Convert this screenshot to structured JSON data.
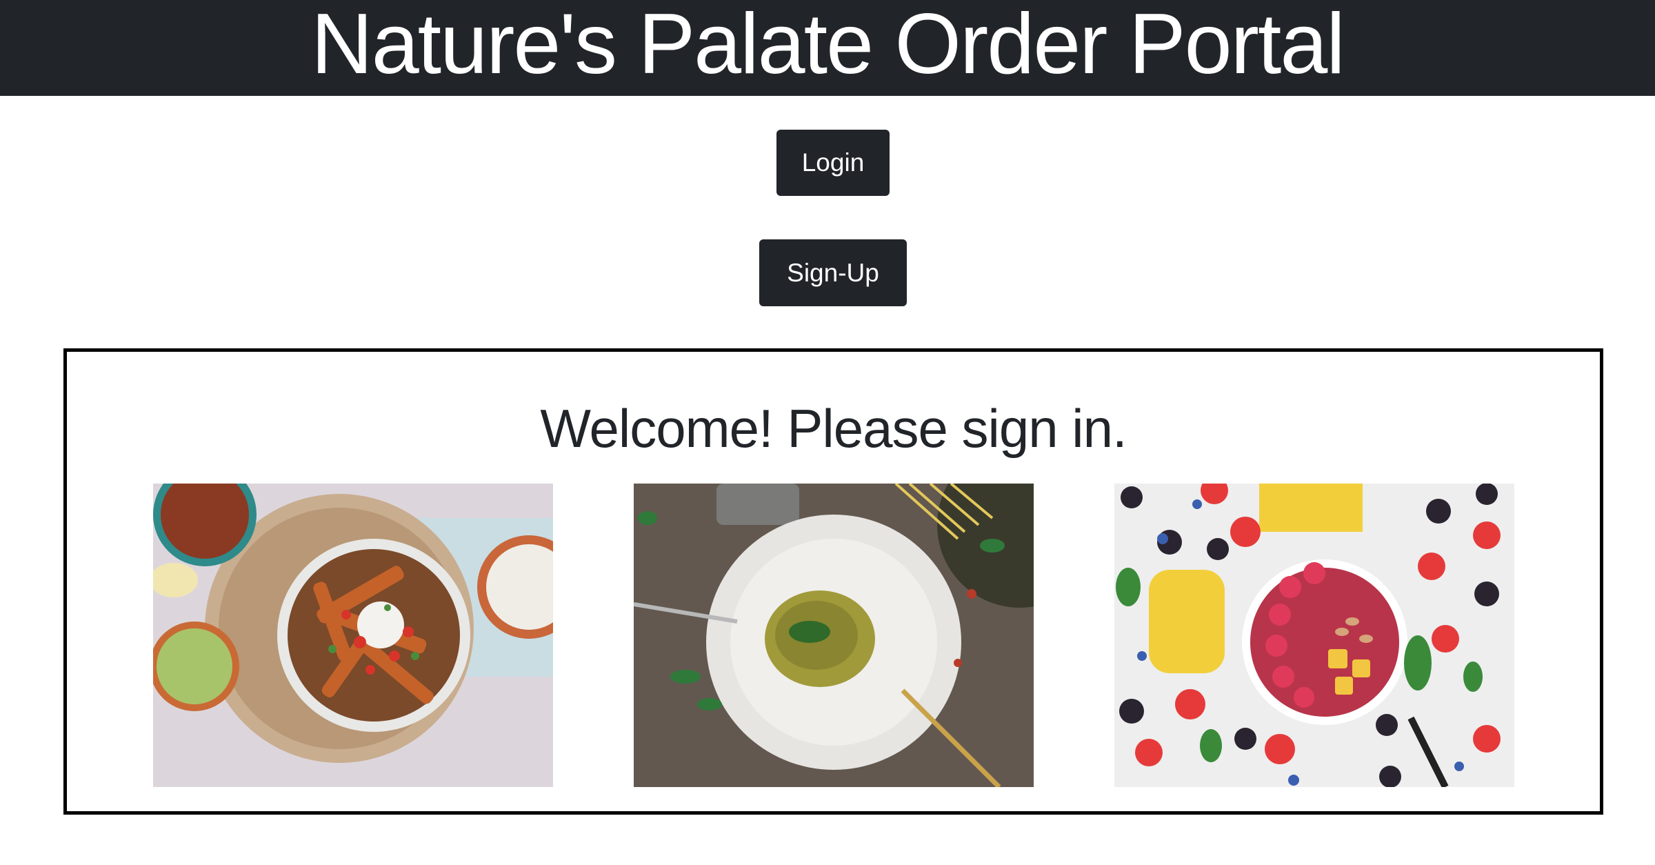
{
  "header": {
    "title": "Nature's Palate Order Portal"
  },
  "actions": {
    "login_label": "Login",
    "signup_label": "Sign-Up"
  },
  "welcome": {
    "message": "Welcome! Please sign in."
  },
  "gallery": [
    {
      "subject": "loaded fries bowl with dips"
    },
    {
      "subject": "pesto pasta on white plate"
    },
    {
      "subject": "fruit smoothie bowl with berries and mango"
    }
  ],
  "colors": {
    "header_bg": "#212529",
    "button_bg": "#212529",
    "button_text": "#ffffff",
    "border": "#000000"
  }
}
